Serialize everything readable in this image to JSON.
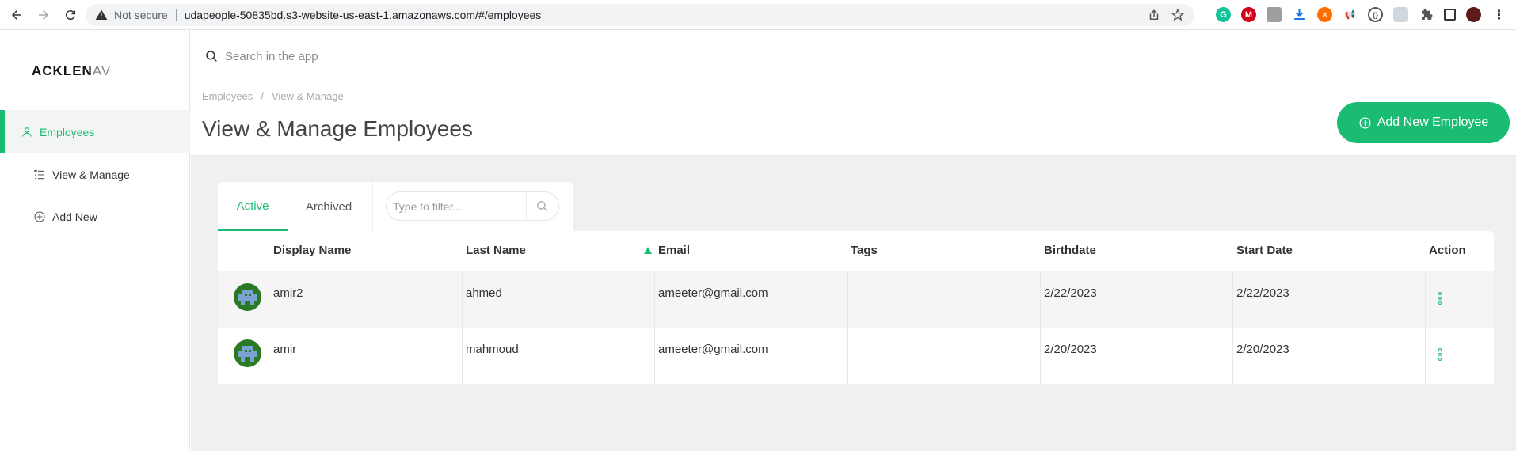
{
  "browser": {
    "not_secure_label": "Not secure",
    "url": "udapeople-50835bd.s3-website-us-east-1.amazonaws.com/#/employees"
  },
  "sidebar": {
    "logo_main": "ACKLEN",
    "logo_fade": "AV",
    "items": [
      {
        "label": "Employees",
        "icon": "user-icon",
        "active": true
      },
      {
        "label": "View & Manage",
        "icon": "list-icon",
        "active": false
      },
      {
        "label": "Add New",
        "icon": "plus-circle-icon",
        "active": false
      }
    ]
  },
  "search": {
    "placeholder": "Search in the app"
  },
  "header": {
    "breadcrumb": [
      "Employees",
      "/",
      "View & Manage"
    ],
    "title": "View & Manage Employees",
    "add_button_label": "Add New Employee"
  },
  "tabs": {
    "items": [
      "Active",
      "Archived"
    ],
    "active": "Active",
    "filter_placeholder": "Type to filter..."
  },
  "table": {
    "columns": [
      "Display Name",
      "Last Name",
      "Email",
      "Tags",
      "Birthdate",
      "Start Date",
      "Action"
    ],
    "sorted_column": "Email",
    "rows": [
      {
        "display_name": "amir2",
        "last_name": "ahmed",
        "email": "ameeter@gmail.com",
        "tags": "",
        "birthdate": "2/22/2023",
        "start_date": "2/22/2023"
      },
      {
        "display_name": "amir",
        "last_name": "mahmoud",
        "email": "ameeter@gmail.com",
        "tags": "",
        "birthdate": "2/20/2023",
        "start_date": "2/20/2023"
      }
    ]
  },
  "colors": {
    "accent": "#1abc73",
    "content_bg": "#eff1f1"
  }
}
